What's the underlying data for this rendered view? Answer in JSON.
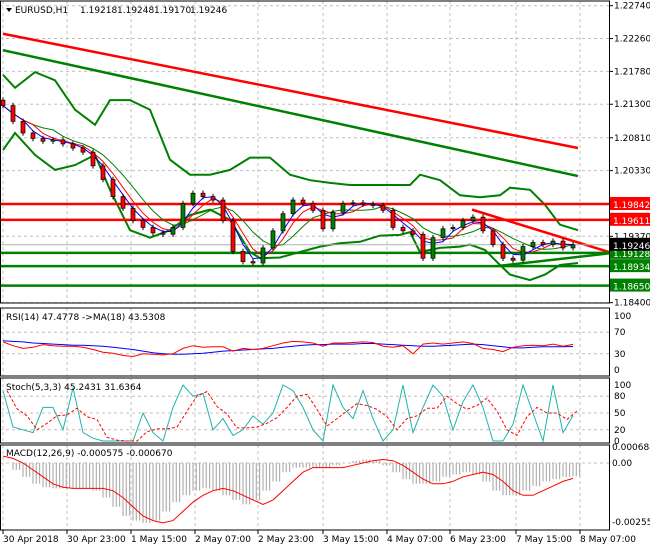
{
  "header": {
    "symbol": "EURUSD,H1",
    "open": "1.19218",
    "high": "1.19248",
    "low": "1.19170",
    "close": "1.19246"
  },
  "chart_data": {
    "type": "candlestick",
    "title": "EURUSD,H1",
    "ylim": [
      1.184,
      1.2274
    ],
    "price_ticks": [
      "1.22740",
      "1.22260",
      "1.21780",
      "1.21300",
      "1.20810",
      "1.20330",
      "1.19370",
      "1.18400"
    ],
    "time_labels": [
      "30 Apr 2018",
      "30 Apr 23:00",
      "1 May 15:00",
      "2 May 07:00",
      "2 May 23:00",
      "3 May 15:00",
      "4 May 07:00",
      "6 May 23:00",
      "7 May 15:00",
      "8 May 07:00"
    ],
    "closes": [
      1.2128,
      1.2105,
      1.2088,
      1.208,
      1.2076,
      1.2078,
      1.2072,
      1.2066,
      1.206,
      1.204,
      1.202,
      1.1995,
      1.1978,
      1.196,
      1.195,
      1.1942,
      1.194,
      1.195,
      1.1985,
      1.2,
      1.1995,
      1.199,
      1.196,
      1.1915,
      1.19,
      1.1898,
      1.192,
      1.1945,
      1.197,
      1.199,
      1.1985,
      1.1975,
      1.1948,
      1.1972,
      1.1985,
      1.1986,
      1.1984,
      1.1982,
      1.1975,
      1.195,
      1.1945,
      1.194,
      1.1905,
      1.1935,
      1.1948,
      1.195,
      1.196,
      1.1965,
      1.1945,
      1.1925,
      1.1905,
      1.1902,
      1.1922,
      1.1928,
      1.1925,
      1.193,
      1.192,
      1.19246
    ],
    "current_price": {
      "value": "1.19246",
      "color": "#000000"
    },
    "levels": [
      {
        "value": "1.19842",
        "color": "#ff0000"
      },
      {
        "value": "1.19611",
        "color": "#ff0000"
      },
      {
        "value": "1.19128",
        "color": "#008000"
      },
      {
        "value": "1.18934",
        "color": "#008000"
      },
      {
        "value": "1.18650",
        "color": "#008000"
      }
    ],
    "trendlines": [
      {
        "color": "#ff0000",
        "from": [
          0,
          1.2233
        ],
        "to": [
          57.5,
          1.2066
        ]
      },
      {
        "color": "#008000",
        "from": [
          0,
          1.2209
        ],
        "to": [
          57.5,
          1.2025
        ]
      },
      {
        "color": "#ff0000",
        "from": [
          46.9,
          1.1976
        ],
        "to": [
          60.6,
          1.1914
        ]
      },
      {
        "color": "#008000",
        "from": [
          49.7,
          1.1894
        ],
        "to": [
          60.6,
          1.1912
        ]
      }
    ],
    "bollinger_upper": [
      [
        0,
        1.2173
      ],
      [
        1.2,
        1.2154
      ],
      [
        3.2,
        1.2177
      ],
      [
        5.2,
        1.2165
      ],
      [
        7.2,
        1.2122
      ],
      [
        9.2,
        1.21
      ],
      [
        10.7,
        1.2136
      ],
      [
        12.7,
        1.2136
      ],
      [
        14.7,
        1.2122
      ],
      [
        16.7,
        1.2049
      ],
      [
        18.7,
        1.2027
      ],
      [
        20.7,
        1.2027
      ],
      [
        22.7,
        1.2034
      ],
      [
        24.7,
        1.2052
      ],
      [
        26.7,
        1.2052
      ],
      [
        28.7,
        1.2027
      ],
      [
        30.7,
        1.2019
      ],
      [
        32.7,
        1.2015
      ],
      [
        34.7,
        1.2012
      ],
      [
        36.7,
        1.2012
      ],
      [
        38.7,
        1.2012
      ],
      [
        40.7,
        1.2012
      ],
      [
        41.7,
        1.2027
      ],
      [
        43.7,
        1.2019
      ],
      [
        45.7,
        1.1997
      ],
      [
        47.7,
        1.1994
      ],
      [
        49.7,
        1.1997
      ],
      [
        50.7,
        1.2008
      ],
      [
        52.7,
        1.2005
      ],
      [
        54.2,
        1.1983
      ],
      [
        55.7,
        1.1954
      ],
      [
        57.5,
        1.1946
      ]
    ],
    "bollinger_lower": [
      [
        0,
        1.2063
      ],
      [
        1.2,
        1.2088
      ],
      [
        3.2,
        1.2056
      ],
      [
        5.2,
        1.2034
      ],
      [
        7.2,
        1.2041
      ],
      [
        9.2,
        1.2056
      ],
      [
        10.7,
        1.2005
      ],
      [
        12.7,
        1.1946
      ],
      [
        14.7,
        1.1935
      ],
      [
        16.7,
        1.1946
      ],
      [
        18.7,
        1.1968
      ],
      [
        20.7,
        1.1976
      ],
      [
        22.7,
        1.1961
      ],
      [
        24.7,
        1.1914
      ],
      [
        25.7,
        1.1905
      ],
      [
        27.7,
        1.1906
      ],
      [
        29.7,
        1.1914
      ],
      [
        31.7,
        1.1922
      ],
      [
        33.7,
        1.1927
      ],
      [
        35.7,
        1.1929
      ],
      [
        37.7,
        1.1938
      ],
      [
        39.7,
        1.1939
      ],
      [
        40.7,
        1.1943
      ],
      [
        41.7,
        1.1914
      ],
      [
        43.7,
        1.192
      ],
      [
        45.7,
        1.1922
      ],
      [
        46.7,
        1.1925
      ],
      [
        48.2,
        1.1917
      ],
      [
        49.7,
        1.1895
      ],
      [
        50.7,
        1.1881
      ],
      [
        52.7,
        1.1873
      ],
      [
        54.2,
        1.1881
      ],
      [
        55.7,
        1.1895
      ],
      [
        57.5,
        1.1898
      ]
    ],
    "ma_colors": {
      "fast": "#0000ff",
      "mid": "#ff0000",
      "slow": "#008000"
    },
    "bull_color": "#008000",
    "bear_color": "#ff0000"
  },
  "rsi": {
    "label": "RSI(14) 47.4778  ->MA(18) 43.5308",
    "ticks": [
      "100",
      "70",
      "30",
      "0"
    ],
    "values": [
      52,
      45,
      40,
      42,
      47,
      45,
      44,
      44,
      42,
      38,
      33,
      31,
      27,
      25,
      30,
      29,
      28,
      30,
      40,
      45,
      42,
      43,
      43,
      35,
      40,
      38,
      40,
      45,
      50,
      53,
      52,
      50,
      44,
      50,
      50,
      51,
      52,
      51,
      44,
      42,
      45,
      30,
      48,
      50,
      48,
      50,
      52,
      49,
      40,
      38,
      34,
      42,
      45,
      46,
      45,
      48,
      44,
      47.48
    ],
    "ma": [
      54,
      53,
      52,
      50,
      49,
      48,
      47,
      46,
      46,
      45,
      44,
      42,
      40,
      38,
      35,
      32,
      30,
      29,
      29,
      30,
      31,
      33,
      35,
      36,
      37,
      38,
      39,
      40,
      42,
      44,
      46,
      47,
      47,
      48,
      48,
      48,
      49,
      49,
      48,
      47,
      46,
      45,
      44,
      44,
      45,
      46,
      47,
      48,
      47,
      45,
      43,
      41,
      41,
      42,
      43,
      43,
      43,
      43.53
    ],
    "color": "#ff0000",
    "ma_color": "#0000ff"
  },
  "stoch": {
    "label": "Stoch(5,3,3) 45.2431 31.6364",
    "ticks": [
      "100",
      "80",
      "50",
      "20",
      "0"
    ],
    "k": [
      90,
      25,
      20,
      15,
      60,
      60,
      20,
      95,
      15,
      5,
      0,
      0,
      0,
      0,
      50,
      15,
      0,
      60,
      100,
      80,
      85,
      20,
      40,
      10,
      20,
      45,
      30,
      50,
      100,
      90,
      60,
      20,
      0,
      100,
      60,
      40,
      90,
      40,
      0,
      20,
      100,
      15,
      60,
      100,
      80,
      20,
      70,
      100,
      60,
      0,
      0,
      30,
      100,
      50,
      0,
      100,
      15,
      45.24
    ],
    "k_color": "#20b2aa",
    "d_color": "#ff0000"
  },
  "macd": {
    "label": "MACD(12,26,9) -0.000575 -0.000670",
    "ticks": [
      "0.000684",
      "0.00",
      "-0.002559"
    ],
    "main": [
      0,
      -0.0003,
      -0.0006,
      -0.0009,
      -0.00105,
      -0.0011,
      -0.0011,
      -0.0011,
      -0.0011,
      -0.0012,
      -0.0015,
      -0.0019,
      -0.0023,
      -0.0025,
      -0.0026,
      -0.0025,
      -0.0021,
      -0.0017,
      -0.0014,
      -0.0012,
      -0.0011,
      -0.0012,
      -0.0014,
      -0.0016,
      -0.0018,
      -0.0016,
      -0.0012,
      -0.0008,
      -0.0004,
      -0.0002,
      -0.0002,
      -0.0002,
      -0.0002,
      -0.0001,
      0,
      0.0001,
      0.00015,
      0.0001,
      -0.0001,
      -0.0004,
      -0.0007,
      -0.0009,
      -0.0009,
      -0.0008,
      -0.0006,
      -0.0005,
      -0.0004,
      -0.0005,
      -0.0008,
      -0.0012,
      -0.0014,
      -0.0014,
      -0.0012,
      -0.001,
      -0.0008,
      -0.0007,
      -0.0006,
      -0.000575
    ],
    "signal": [
      0.0003,
      0.0002,
      0,
      -0.0003,
      -0.0006,
      -0.0009,
      -0.00105,
      -0.0011,
      -0.0011,
      -0.0011,
      -0.0011,
      -0.0012,
      -0.0015,
      -0.0019,
      -0.0023,
      -0.0025,
      -0.0026,
      -0.0025,
      -0.0021,
      -0.0017,
      -0.0014,
      -0.0012,
      -0.0011,
      -0.0012,
      -0.0014,
      -0.0016,
      -0.0018,
      -0.0016,
      -0.0012,
      -0.0008,
      -0.0004,
      -0.0002,
      -0.0002,
      -0.0002,
      -0.0002,
      -0.0001,
      0,
      0.0001,
      0.00015,
      0.0001,
      -0.0001,
      -0.0004,
      -0.0007,
      -0.0009,
      -0.0009,
      -0.0008,
      -0.0006,
      -0.0005,
      -0.0004,
      -0.0005,
      -0.0008,
      -0.0012,
      -0.0014,
      -0.0014,
      -0.0012,
      -0.001,
      -0.0008,
      -0.00067
    ],
    "hist_color": "#b0b0b0",
    "signal_color": "#ff0000"
  }
}
